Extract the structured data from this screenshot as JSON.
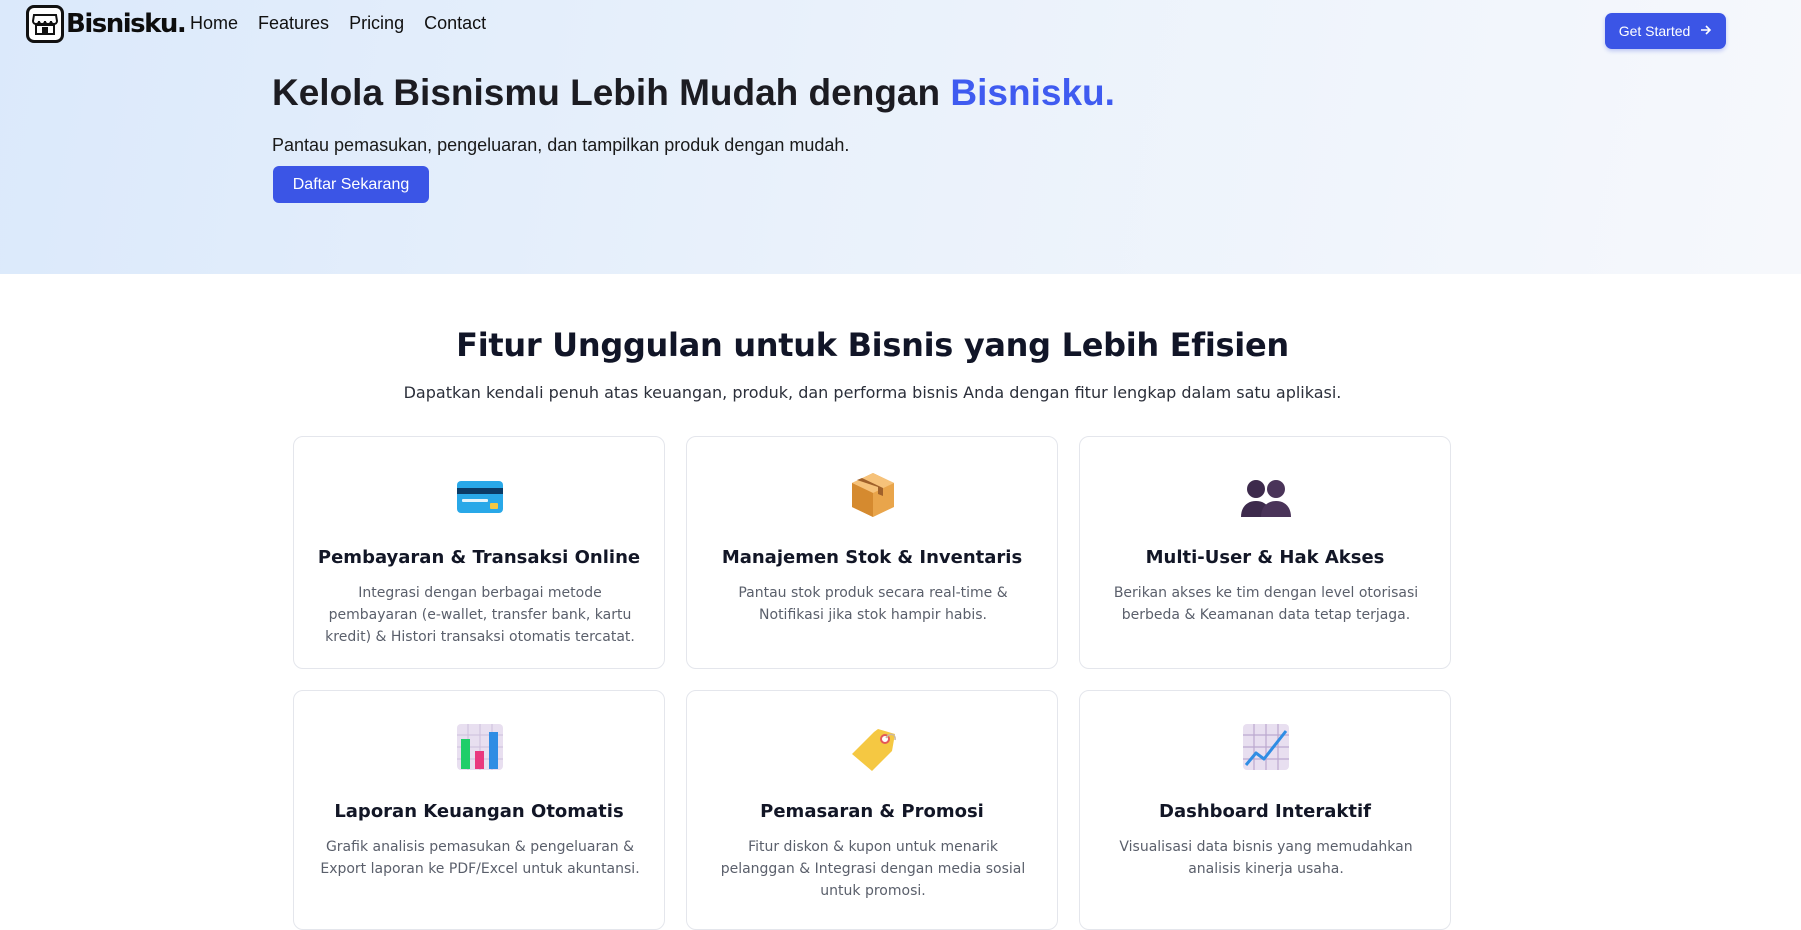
{
  "brand": {
    "name": "Bisnisku."
  },
  "nav": {
    "items": [
      "Home",
      "Features",
      "Pricing",
      "Contact"
    ],
    "cta_label": "Get Started",
    "cta_icon": "arrow-right-icon"
  },
  "hero": {
    "title_main": "Kelola Bisnismu Lebih Mudah dengan ",
    "title_accent": "Bisnisku.",
    "subtitle": "Pantau pemasukan, pengeluaran, dan tampilkan produk dengan mudah.",
    "button_label": "Daftar Sekarang"
  },
  "features": {
    "title": "Fitur Unggulan untuk Bisnis yang Lebih Efisien",
    "subtitle": "Dapatkan kendali penuh atas keuangan, produk, dan performa bisnis Anda dengan fitur lengkap dalam satu aplikasi.",
    "cards": [
      {
        "icon": "credit-card-icon",
        "title": "Pembayaran & Transaksi Online",
        "desc": "Integrasi dengan berbagai metode pembayaran (e-wallet, transfer bank, kartu kredit) & Histori transaksi otomatis tercatat."
      },
      {
        "icon": "package-icon",
        "title": "Manajemen Stok & Inventaris",
        "desc": "Pantau stok produk secara real-time & Notifikasi jika stok hampir habis."
      },
      {
        "icon": "users-icon",
        "title": "Multi-User & Hak Akses",
        "desc": "Berikan akses ke tim dengan level otorisasi berbeda & Keamanan data tetap terjaga."
      },
      {
        "icon": "bar-chart-icon",
        "title": "Laporan Keuangan Otomatis",
        "desc": "Grafik analisis pemasukan & pengeluaran & Export laporan ke PDF/Excel untuk akuntansi."
      },
      {
        "icon": "price-tag-icon",
        "title": "Pemasaran & Promosi",
        "desc": "Fitur diskon & kupon untuk menarik pelanggan & Integrasi dengan media sosial untuk promosi."
      },
      {
        "icon": "line-chart-icon",
        "title": "Dashboard Interaktif",
        "desc": "Visualisasi data bisnis yang memudahkan analisis kinerja usaha."
      }
    ]
  },
  "colors": {
    "primary": "#3b55e6",
    "accent_text": "#3f5bf0"
  }
}
